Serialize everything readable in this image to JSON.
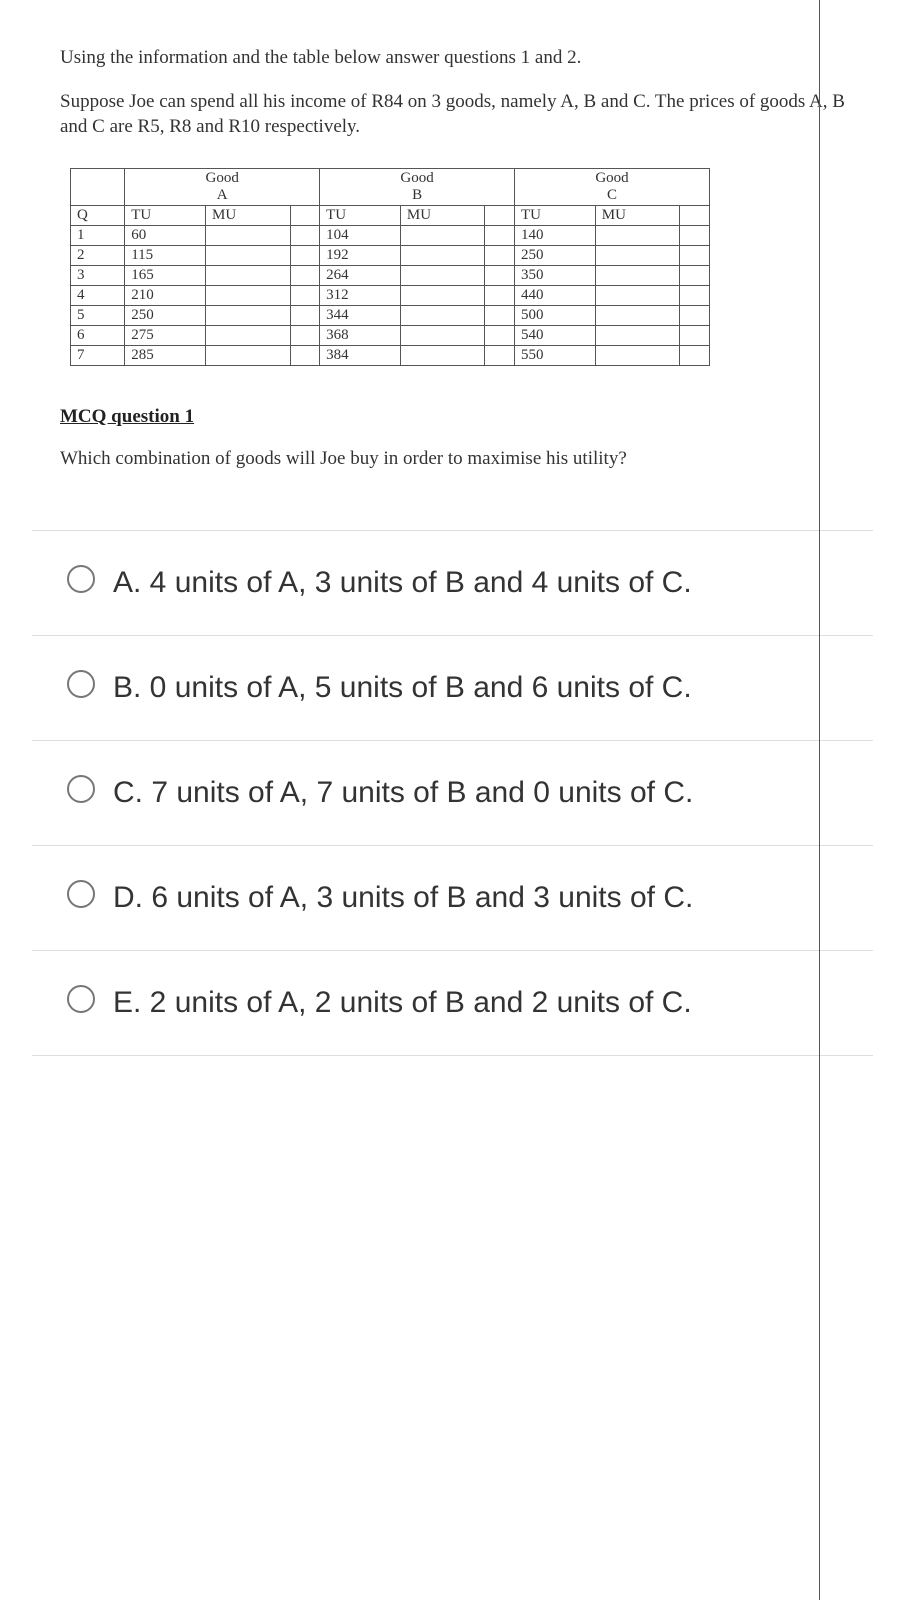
{
  "intro": {
    "line1": "Using the information and the table below answer questions 1 and 2.",
    "line2": "Suppose Joe can spend all his income of R84 on 3 goods, namely A, B and C. The prices of goods A, B and C are R5, R8 and R10 respectively."
  },
  "table": {
    "groupA": "Good A",
    "groupB": "Good B",
    "groupC": "Good C",
    "headers": {
      "q": "Q",
      "tu": "TU",
      "mu": "MU"
    },
    "rows": [
      {
        "q": "1",
        "tuA": "60",
        "tuB": "104",
        "tuC": "140"
      },
      {
        "q": "2",
        "tuA": "115",
        "tuB": "192",
        "tuC": "250"
      },
      {
        "q": "3",
        "tuA": "165",
        "tuB": "264",
        "tuC": "350"
      },
      {
        "q": "4",
        "tuA": "210",
        "tuB": "312",
        "tuC": "440"
      },
      {
        "q": "5",
        "tuA": "250",
        "tuB": "344",
        "tuC": "500"
      },
      {
        "q": "6",
        "tuA": "275",
        "tuB": "368",
        "tuC": "540"
      },
      {
        "q": "7",
        "tuA": "285",
        "tuB": "384",
        "tuC": "550"
      }
    ]
  },
  "mcq": {
    "heading": "MCQ question 1",
    "question": "Which combination of goods will Joe buy in order to maximise his utility?",
    "options": {
      "a": "A. 4 units of A, 3 units of B and 4 units of C.",
      "b": "B. 0 units of A, 5 units of B and 6 units of C.",
      "c": "C. 7 units of A, 7 units of B and 0 units of C.",
      "d": "D. 6 units of A, 3 units of B and 3 units of C.",
      "e": "E. 2 units of A, 2 units of B and 2 units of C."
    }
  },
  "chart_data": {
    "type": "table",
    "title": "Total Utility for Goods A, B, C by Quantity",
    "columns": [
      "Q",
      "TU Good A",
      "MU Good A",
      "TU Good B",
      "MU Good B",
      "TU Good C",
      "MU Good C"
    ],
    "rows": [
      [
        1,
        60,
        null,
        104,
        null,
        140,
        null
      ],
      [
        2,
        115,
        null,
        192,
        null,
        250,
        null
      ],
      [
        3,
        165,
        null,
        264,
        null,
        350,
        null
      ],
      [
        4,
        210,
        null,
        312,
        null,
        440,
        null
      ],
      [
        5,
        250,
        null,
        344,
        null,
        500,
        null
      ],
      [
        6,
        275,
        null,
        368,
        null,
        540,
        null
      ],
      [
        7,
        285,
        null,
        384,
        null,
        550,
        null
      ]
    ]
  }
}
